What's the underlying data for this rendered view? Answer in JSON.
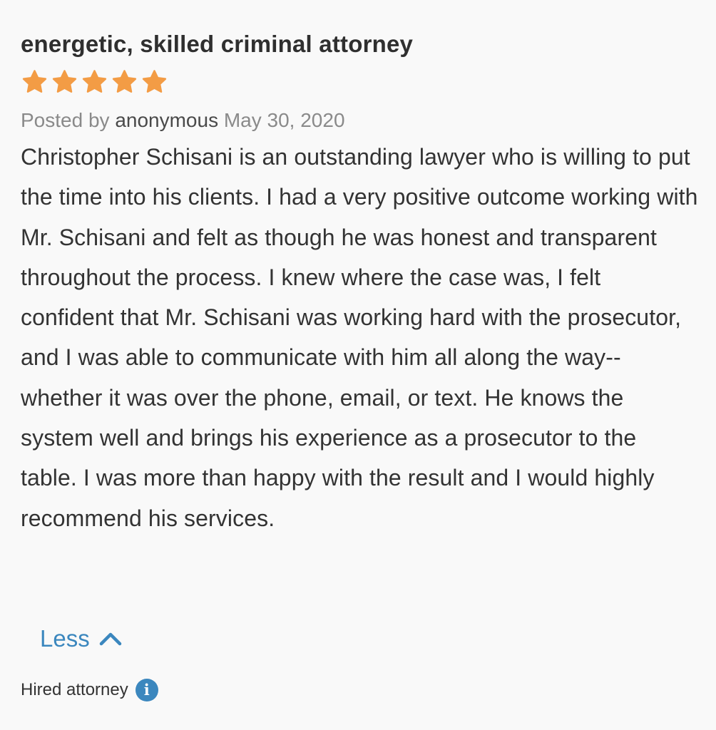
{
  "review": {
    "title": "energetic, skilled criminal attorney",
    "rating": 5,
    "rating_max": 5,
    "star_color": "#f39c45",
    "posted_by_label": "Posted by",
    "author": "anonymous",
    "date": "May 30, 2020",
    "body": "Christopher Schisani is an outstanding lawyer who is willing to put the time into his clients. I had a very positive outcome working with Mr. Schisani and felt as though he was honest and transparent throughout the process. I knew where the case was, I felt confident that Mr. Schisani was working hard with the prosecutor, and I was able to communicate with him all along the way--whether it was over the phone, email, or text. He knows the system well and brings his experience as a prosecutor to the table. I was more than happy with the result and I would highly recommend his services."
  },
  "toggle": {
    "label": "Less",
    "icon": "chevron-up-icon",
    "color": "#3b87be"
  },
  "footer": {
    "hired_label": "Hired attorney",
    "info_icon": "info-icon",
    "info_glyph": "i"
  }
}
